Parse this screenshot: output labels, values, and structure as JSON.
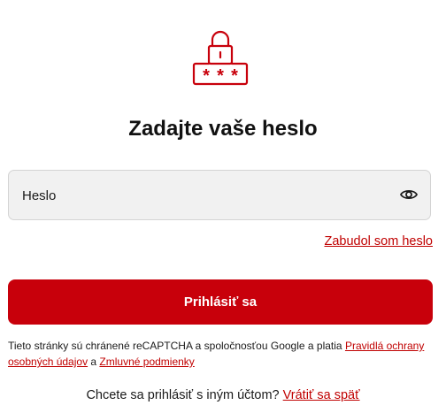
{
  "header": {
    "icon": "password-lock-icon",
    "title": "Zadajte vaše heslo"
  },
  "password": {
    "label": "Heslo",
    "toggle_icon": "eye-icon"
  },
  "links": {
    "forgot_password": "Zabudol som heslo"
  },
  "login_button": {
    "label": "Prihlásiť sa"
  },
  "recaptcha": {
    "text_before": "Tieto stránky sú chránené reCAPTCHA a spoločnosťou Google a platia ",
    "privacy_link": "Pravidlá ochrany osobných údajov",
    "text_middle": " a ",
    "terms_link": "Zmluvné podmienky"
  },
  "switch_account": {
    "question": "Chcete sa prihlásiť s iným účtom?",
    "back_link": "Vrátiť sa späť"
  },
  "colors": {
    "accent": "#c8000b",
    "link": "#c00000",
    "field_bg": "#f1f1f1"
  }
}
